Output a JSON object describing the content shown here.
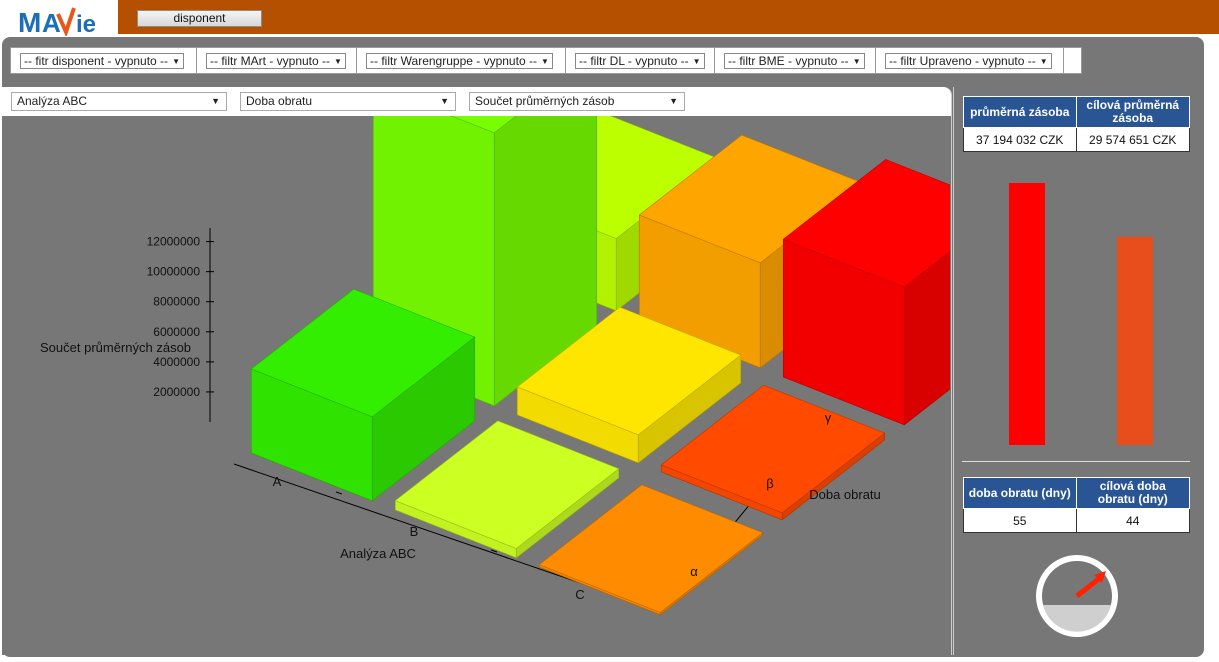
{
  "app": {
    "logo_text": "MAVIE",
    "tab_label": "disponent"
  },
  "filters": [
    {
      "label": "-- fitr disponent - vypnuto --"
    },
    {
      "label": "-- filtr MArt - vypnuto --"
    },
    {
      "label": "-- filtr Warengruppe - vypnuto --"
    },
    {
      "label": "-- filtr DL - vypnuto --"
    },
    {
      "label": "-- filtr BME - vypnuto --"
    },
    {
      "label": "-- filtr Upraveno - vypnuto --"
    }
  ],
  "chart_controls": {
    "x_axis_select": "Analýza ABC",
    "z_axis_select": "Doba obratu",
    "value_select": "Součet průměrných zásob"
  },
  "chart_data": {
    "type": "bar3d",
    "ylabel": "Součet průměrných zásob",
    "xlabel": "Analýza ABC",
    "zlabel": "Doba obratu",
    "x_categories": [
      "A",
      "B",
      "C"
    ],
    "z_categories": [
      "α",
      "β",
      "γ"
    ],
    "y_ticks": [
      2000000,
      4000000,
      6000000,
      8000000,
      10000000,
      12000000
    ],
    "ylim": [
      0,
      12000000
    ],
    "bars": [
      {
        "x": "A",
        "z": "α",
        "value": 3600000,
        "color": "#33ee00"
      },
      {
        "x": "A",
        "z": "β",
        "value": 11700000,
        "color": "#77ff00"
      },
      {
        "x": "A",
        "z": "γ",
        "value": 3100000,
        "color": "#bbff00"
      },
      {
        "x": "B",
        "z": "α",
        "value": 400000,
        "color": "#ccff22"
      },
      {
        "x": "B",
        "z": "β",
        "value": 1200000,
        "color": "#ffe600"
      },
      {
        "x": "B",
        "z": "γ",
        "value": 4500000,
        "color": "#ffa500"
      },
      {
        "x": "C",
        "z": "α",
        "value": 100000,
        "color": "#ff8c00"
      },
      {
        "x": "C",
        "z": "β",
        "value": 300000,
        "color": "#ff4a00"
      },
      {
        "x": "C",
        "z": "γ",
        "value": 5900000,
        "color": "#ff0000"
      }
    ]
  },
  "stock_kpi": {
    "header_avg": "průměrná zásoba",
    "header_target": "cílová průměrná zásoba",
    "avg_value": "37 194 032 CZK",
    "target_value": "29 574 651 CZK",
    "avg_amount": 37194032,
    "target_amount": 29574651,
    "avg_color": "#ff0000",
    "target_color": "#e84e1b"
  },
  "turnover_kpi": {
    "header_actual": "doba obratu (dny)",
    "header_target": "cílová doba obratu (dny)",
    "actual_value": "55",
    "target_value": "44"
  }
}
